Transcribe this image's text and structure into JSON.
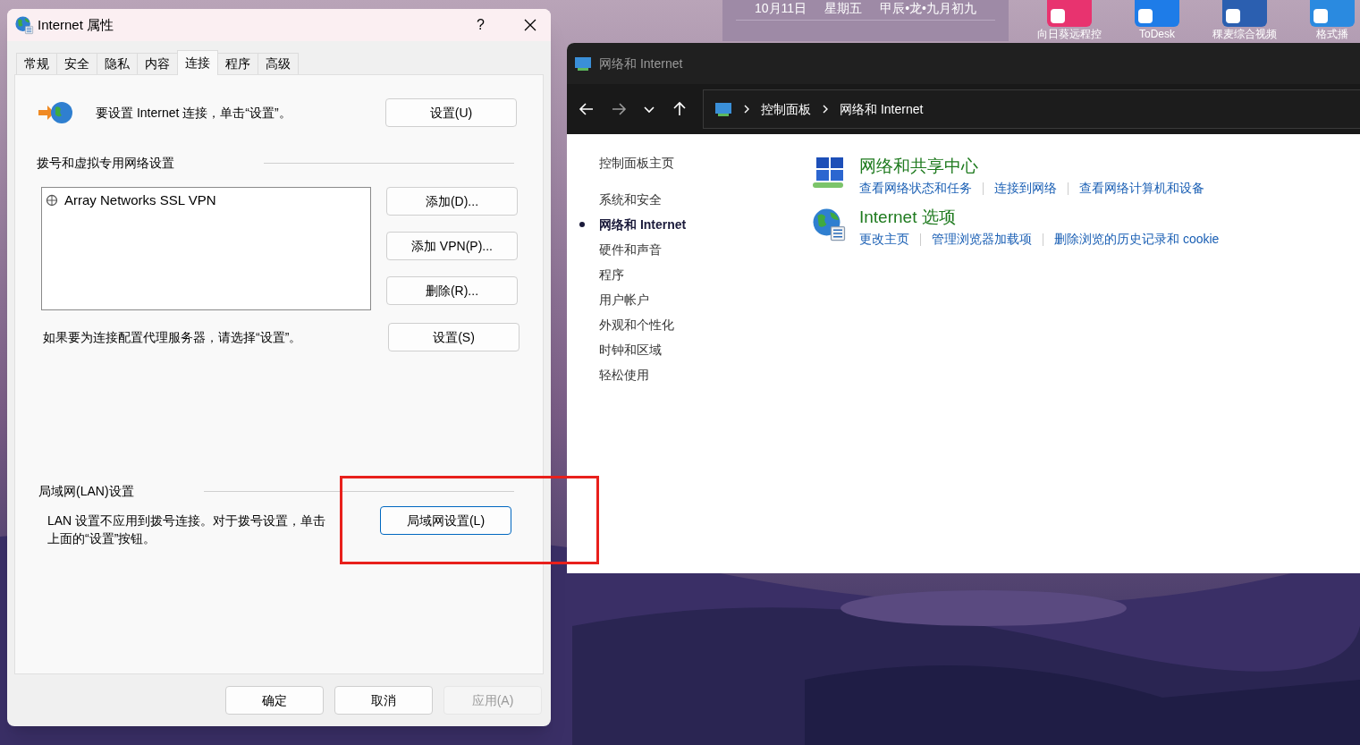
{
  "desktop": {
    "widget": {
      "date": "10月11日",
      "weekday": "星期五",
      "lunar": "甲辰•龙•九月初九"
    },
    "shortcuts": [
      {
        "label": "向日葵远程控"
      },
      {
        "label": "ToDesk"
      },
      {
        "label": "稞麦综合视频"
      },
      {
        "label": "格式播"
      }
    ]
  },
  "dialog": {
    "title": "Internet 属性",
    "help": "?",
    "tabs": [
      {
        "label": "常规",
        "selected": false
      },
      {
        "label": "安全",
        "selected": false
      },
      {
        "label": "隐私",
        "selected": false
      },
      {
        "label": "内容",
        "selected": false
      },
      {
        "label": "连接",
        "selected": true
      },
      {
        "label": "程序",
        "selected": false
      },
      {
        "label": "高级",
        "selected": false
      }
    ],
    "setup": {
      "text": "要设置 Internet 连接，单击“设置”。",
      "button": {
        "label": "设置(U)",
        "focused": false
      }
    },
    "vpn": {
      "heading": "拨号和虚拟专用网络设置",
      "connections": [
        {
          "name": "Array Networks SSL VPN"
        }
      ],
      "buttons": [
        {
          "label": "添加(D)...",
          "focused": false
        },
        {
          "label": "添加 VPN(P)...",
          "focused": false
        },
        {
          "label": "删除(R)...",
          "focused": false
        }
      ],
      "proxy_text": "如果要为连接配置代理服务器，请选择“设置”。",
      "proxy_button": {
        "label": "设置(S)",
        "focused": false
      }
    },
    "lan": {
      "heading": "局域网(LAN)设置",
      "text": "LAN 设置不应用到拨号连接。对于拨号设置，单击上面的“设置”按钮。",
      "button": {
        "label": "局域网设置(L)",
        "focused": true
      }
    },
    "footer": [
      {
        "label": "确定",
        "disabled": false
      },
      {
        "label": "取消",
        "disabled": false
      },
      {
        "label": "应用(A)",
        "disabled": true
      }
    ]
  },
  "control_panel": {
    "title": "网络和 Internet",
    "breadcrumb": [
      "控制面板",
      "网络和 Internet"
    ],
    "sidebar": [
      {
        "label": "控制面板主页",
        "selected": false
      },
      {
        "label": "系统和安全",
        "selected": false
      },
      {
        "label": "网络和 Internet",
        "selected": true
      },
      {
        "label": "硬件和声音",
        "selected": false
      },
      {
        "label": "程序",
        "selected": false
      },
      {
        "label": "用户帐户",
        "selected": false
      },
      {
        "label": "外观和个性化",
        "selected": false
      },
      {
        "label": "时钟和区域",
        "selected": false
      },
      {
        "label": "轻松使用",
        "selected": false
      }
    ],
    "categories": [
      {
        "kind": "network",
        "title": "网络和共享中心",
        "links": [
          "查看网络状态和任务",
          "连接到网络",
          "查看网络计算机和设备"
        ]
      },
      {
        "kind": "internet",
        "title": "Internet 选项",
        "links": [
          "更改主页",
          "管理浏览器加载项",
          "删除浏览的历史记录和 cookie"
        ]
      }
    ]
  },
  "annotation": {
    "kind": "highlight"
  }
}
